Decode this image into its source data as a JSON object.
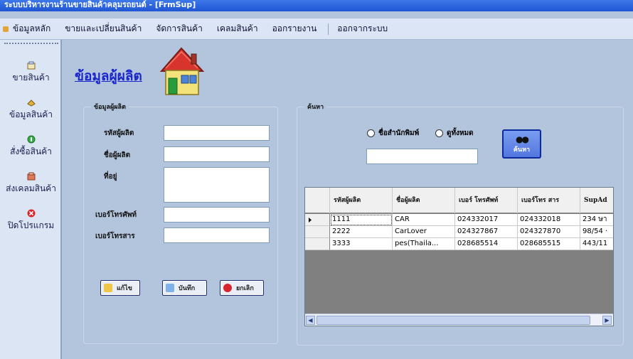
{
  "window": {
    "title": "ระบบบริหารงานร้านขายสินค้าคลุมรถยนต์ - [FrmSup]"
  },
  "menu": [
    {
      "label": "ข้อมูลหลัก"
    },
    {
      "label": "ขายและเปลี่ยนสินค้า"
    },
    {
      "label": "จัดการสินค้า"
    },
    {
      "label": "เคลมสินค้า"
    },
    {
      "label": "ออกรายงาน"
    },
    {
      "label": "ออกจากระบบ"
    }
  ],
  "sidebar": [
    {
      "label": "ขายสินค้า",
      "icon": "sale-icon"
    },
    {
      "label": "ข้อมูลสินค้า",
      "icon": "product-icon"
    },
    {
      "label": "สั่งซื้อสินค้า",
      "icon": "order-icon"
    },
    {
      "label": "ส่งเคลมสินค้า",
      "icon": "claim-icon"
    },
    {
      "label": "ปิดโปรแกรม",
      "icon": "close-icon"
    }
  ],
  "page": {
    "title": "ข้อมูลผู้ผลิต"
  },
  "form": {
    "group_title": "ข้อมูลผู้ผลิต",
    "code_label": "รหัสผู้ผลิต",
    "code_value": "",
    "name_label": "ชื่อผู้ผลิต",
    "name_value": "",
    "address_label": "ที่อยู่",
    "address_value": "",
    "phone_label": "เบอร์โทรศัพท์",
    "phone_value": "",
    "fax_label": "เบอร์โทรสาร",
    "fax_value": "",
    "edit_label": "แก้ไข",
    "save_label": "บันทึก",
    "cancel_label": "ยกเลิก"
  },
  "search": {
    "group_title": "ค้นหา",
    "radio_publisher": "ชื่อสำนักพิมพ์",
    "radio_all": "ดูทั้งหมด",
    "input_value": "",
    "button_label": "ค้นหา"
  },
  "grid": {
    "columns": [
      "รหัสผู้ผลิต",
      "ชื่อผู้ผลิต",
      "เบอร์ โทรศัพท์",
      "เบอร์โทร สาร",
      "SupAd"
    ],
    "rows": [
      [
        "1111",
        "CAR",
        "024332017",
        "024332018",
        "234 ษา"
      ],
      [
        "2222",
        "CarLover",
        "024327867",
        "024327870",
        "98/54 ·"
      ],
      [
        "3333",
        "pes(Thaila...",
        "028685514",
        "028685515",
        "443/11"
      ]
    ]
  }
}
